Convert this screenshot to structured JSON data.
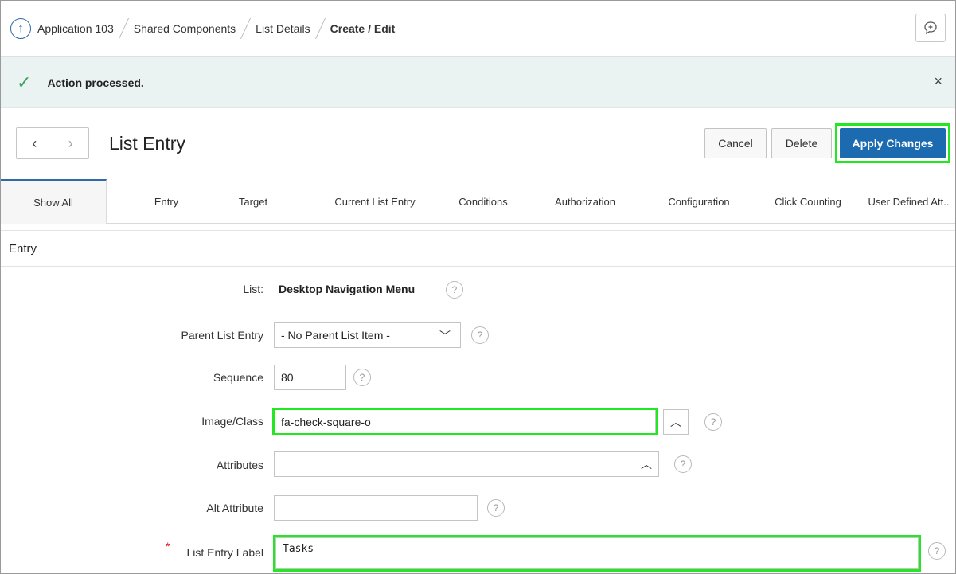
{
  "breadcrumb": {
    "items": [
      "Application 103",
      "Shared Components",
      "List Details"
    ],
    "current": "Create / Edit"
  },
  "message": {
    "text": "Action processed.",
    "close_icon": "×"
  },
  "title": {
    "text": "List Entry",
    "prev_icon": "‹",
    "next_icon": "›"
  },
  "buttons": {
    "cancel": "Cancel",
    "delete": "Delete",
    "apply": "Apply Changes"
  },
  "tabs": [
    "Show All",
    "Entry",
    "Target",
    "Current List Entry",
    "Conditions",
    "Authorization",
    "Configuration",
    "Click Counting",
    "User Defined Att.."
  ],
  "region": {
    "title": "Entry"
  },
  "form": {
    "list": {
      "label": "List:",
      "value": "Desktop Navigation Menu"
    },
    "parent": {
      "label": "Parent List Entry",
      "value": "- No Parent List Item -"
    },
    "sequence": {
      "label": "Sequence",
      "value": "80"
    },
    "image_class": {
      "label": "Image/Class",
      "value": "fa-check-square-o"
    },
    "attributes": {
      "label": "Attributes",
      "value": ""
    },
    "alt_attribute": {
      "label": "Alt Attribute",
      "value": ""
    },
    "entry_label": {
      "label": "List Entry Label",
      "value": "Tasks",
      "required_mark": "*"
    }
  },
  "icons": {
    "help": "?",
    "chevron_up": "︿",
    "chevron_down": "﹀"
  },
  "colors": {
    "primary": "#1c6ab0",
    "highlight": "#22e822",
    "success_bg": "#eaf3f1",
    "success_icon": "#3aa35a"
  }
}
